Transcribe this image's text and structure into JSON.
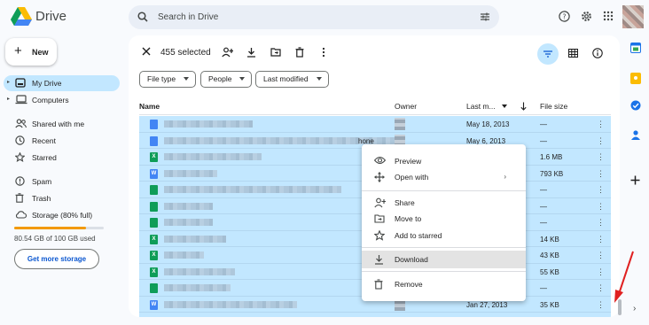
{
  "app": {
    "name": "Drive"
  },
  "search": {
    "placeholder": "Search in Drive"
  },
  "sidebar": {
    "new_label": "New",
    "items": [
      {
        "label": "My Drive",
        "icon": "drive-icon",
        "active": true,
        "caret": "▸"
      },
      {
        "label": "Computers",
        "icon": "computer-icon",
        "caret": "▸"
      },
      {
        "label": "Shared with me",
        "icon": "people-icon"
      },
      {
        "label": "Recent",
        "icon": "clock-icon"
      },
      {
        "label": "Starred",
        "icon": "star-icon"
      },
      {
        "label": "Spam",
        "icon": "spam-icon"
      },
      {
        "label": "Trash",
        "icon": "trash-icon"
      },
      {
        "label": "Storage (80% full)",
        "icon": "cloud-icon"
      }
    ],
    "storage_used_fraction": 0.8,
    "storage_text": "80.54 GB of 100 GB used",
    "get_storage_label": "Get more storage"
  },
  "selection": {
    "count_label": "455 selected"
  },
  "filters": [
    {
      "label": "File type"
    },
    {
      "label": "People"
    },
    {
      "label": "Last modified"
    }
  ],
  "columns": {
    "name": "Name",
    "owner": "Owner",
    "modified": "Last m...",
    "size": "File size"
  },
  "rows": [
    {
      "type": "doc",
      "modified": "May 18, 2013",
      "size": "—"
    },
    {
      "type": "doc",
      "modified": "May 6, 2013",
      "size": "—",
      "suffix": "hone"
    },
    {
      "type": "sheet",
      "modified": "",
      "size": "1.6 MB"
    },
    {
      "type": "word",
      "modified": "",
      "size": "793 KB"
    },
    {
      "type": "sheet-g",
      "modified": "",
      "size": "—"
    },
    {
      "type": "sheet-g",
      "modified": "",
      "size": "—"
    },
    {
      "type": "sheet-g",
      "modified": "",
      "size": "—"
    },
    {
      "type": "sheet",
      "modified": "",
      "size": "14 KB"
    },
    {
      "type": "sheet",
      "modified": "",
      "size": "43 KB"
    },
    {
      "type": "sheet",
      "modified": "",
      "size": "55 KB"
    },
    {
      "type": "sheet-g",
      "modified": "",
      "size": "—"
    },
    {
      "type": "word",
      "modified": "Jan 27, 2013",
      "size": "35 KB"
    }
  ],
  "context_menu": {
    "items": [
      {
        "label": "Preview",
        "icon": "eye-icon"
      },
      {
        "label": "Open with",
        "icon": "open-with-icon",
        "arrow": "›"
      },
      {
        "label": "Share",
        "icon": "share-icon"
      },
      {
        "label": "Move to",
        "icon": "move-to-icon"
      },
      {
        "label": "Add to starred",
        "icon": "star-icon"
      },
      {
        "label": "Download",
        "icon": "download-icon",
        "highlighted": true
      },
      {
        "label": "Remove",
        "icon": "trash-icon"
      }
    ]
  },
  "colors": {
    "accent": "#0b57d0",
    "selected": "#c2e7ff",
    "storage": "#f29900"
  }
}
